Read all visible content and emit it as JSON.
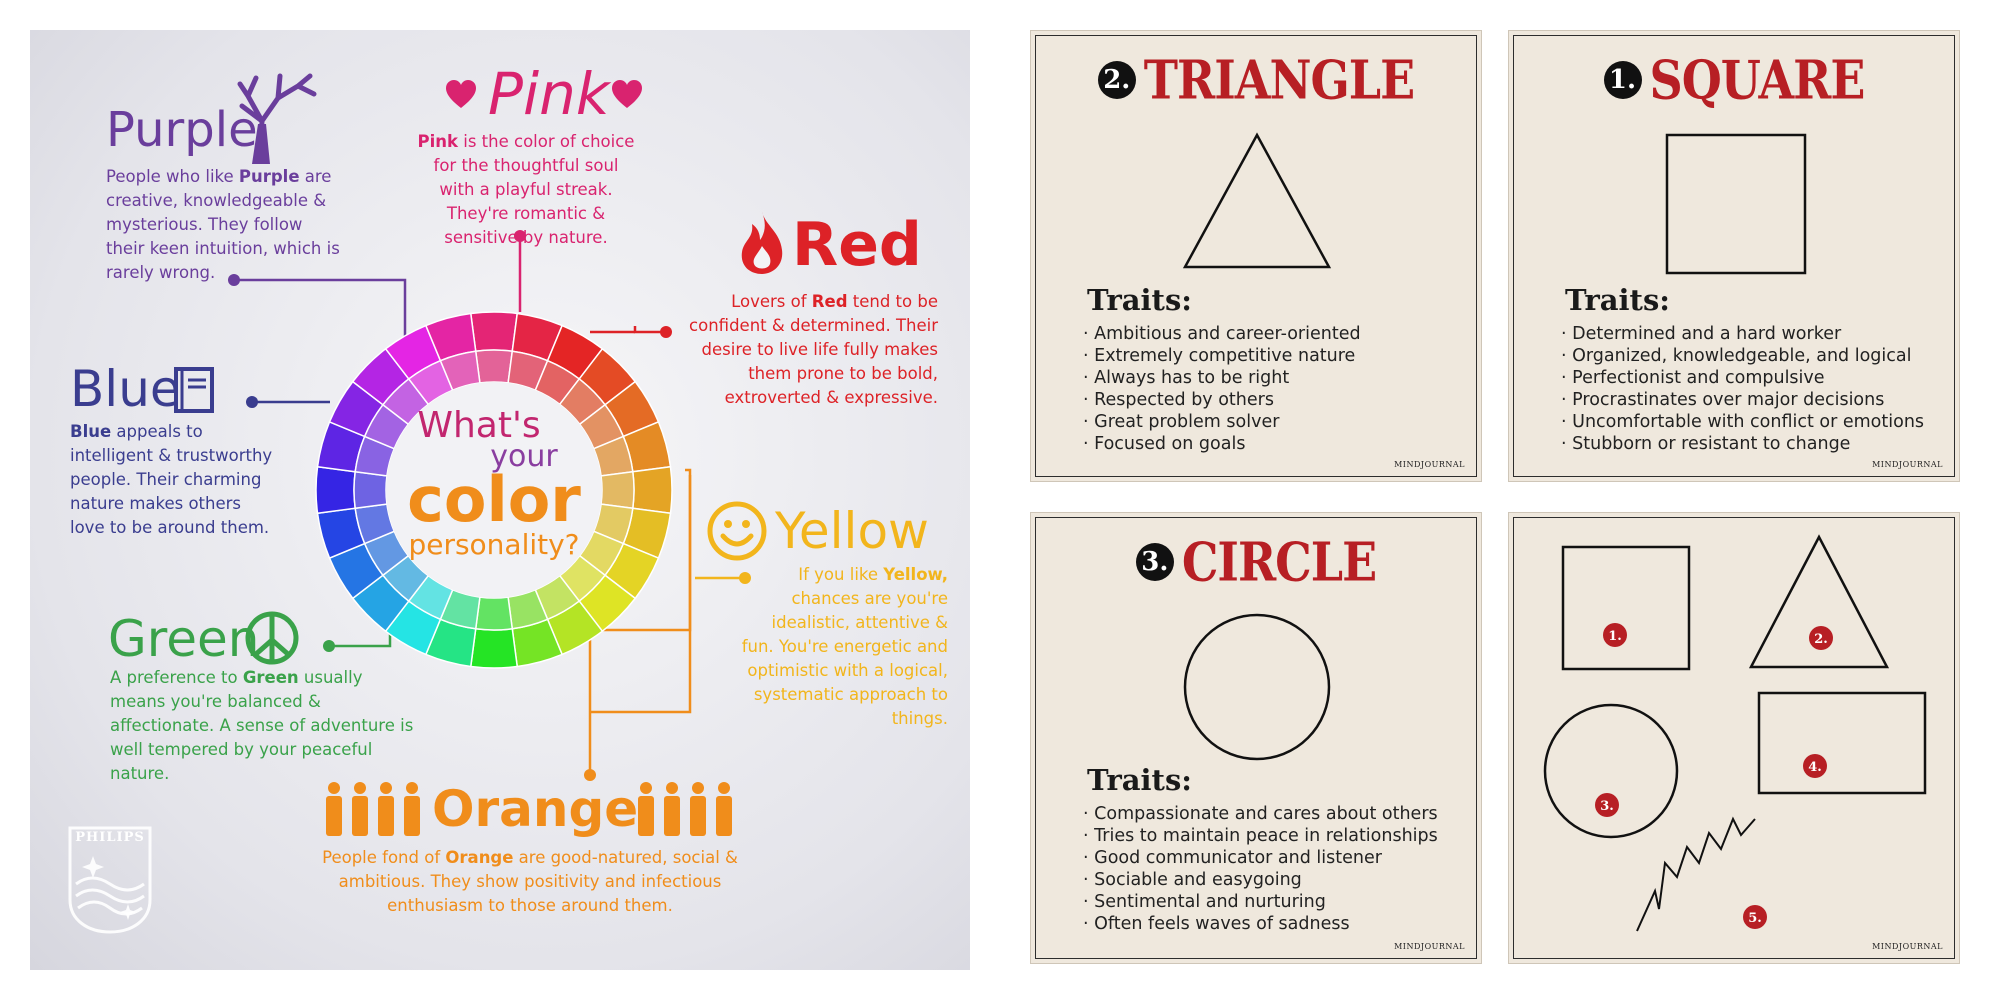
{
  "infographic": {
    "center": {
      "line1": "What's",
      "line2": "your",
      "line3": "color",
      "line4": "personality?"
    },
    "purple": {
      "title": "Purple",
      "text_pre": "People who like ",
      "text_bold": "Purple",
      "text_post": " are creative, knowledgeable & mysterious. They follow their keen intuition, which is rarely wrong."
    },
    "pink": {
      "title": "Pink",
      "text_bold": "Pink",
      "text_post": " is the color of choice for the thoughtful soul with a playful streak. They're romantic & sensitive by nature."
    },
    "red": {
      "title": "Red",
      "text_pre": "Lovers of ",
      "text_bold": "Red",
      "text_post": " tend to be confident & determined. Their desire to live life fully makes them prone to be bold, extroverted & expressive."
    },
    "blue": {
      "title": "Blue",
      "text_bold": "Blue",
      "text_post": " appeals to intelligent & trustworthy people. Their charming nature makes others love to be around them."
    },
    "yellow": {
      "title": "Yellow",
      "text_pre": "If you like ",
      "text_bold": "Yellow,",
      "text_post": " chances are you're idealistic, attentive & fun. You're energetic and optimistic with a logical, systematic approach to things."
    },
    "green": {
      "title": "Green",
      "text_pre": "A preference to ",
      "text_bold": "Green",
      "text_post": " usually means you're balanced & affectionate. A sense of adventure is well tempered by your peaceful nature."
    },
    "orange": {
      "title": "Orange",
      "text_pre": "People fond of ",
      "text_bold": "Orange",
      "text_post": " are good-natured, social & ambitious. They show positivity and infectious enthusiasm to those around them."
    },
    "brand": "PHILIPS",
    "colors": {
      "purple": "#6a3e9c",
      "pink": "#d9236f",
      "red": "#dd2227",
      "blue": "#3a3d8f",
      "green": "#3aa24a",
      "yellow": "#f2b51c",
      "orange": "#f08d1b"
    },
    "icons": [
      "tree-icon",
      "heart-icon",
      "flame-icon",
      "book-icon",
      "smiley-icon",
      "peace-icon",
      "people-icon",
      "philips-logo"
    ]
  },
  "cards": [
    {
      "num": "2.",
      "title": "TRIANGLE",
      "traits_label": "Traits:",
      "brand": "MINDJOURNAL",
      "traits": [
        "Ambitious and career-oriented",
        "Extremely competitive nature",
        "Always has to be right",
        "Respected by others",
        "Great problem solver",
        "Focused on goals"
      ]
    },
    {
      "num": "1.",
      "title": "SQUARE",
      "traits_label": "Traits:",
      "brand": "MINDJOURNAL",
      "traits": [
        "Determined and a hard worker",
        "Organized, knowledgeable, and logical",
        "Perfectionist and compulsive",
        "Procrastinates over major decisions",
        "Uncomfortable with conflict or emotions",
        "Stubborn or resistant to change"
      ]
    },
    {
      "num": "3.",
      "title": "CIRCLE",
      "traits_label": "Traits:",
      "brand": "MINDJOURNAL",
      "traits": [
        "Compassionate and cares about others",
        "Tries to maintain peace in relationships",
        "Good communicator and listener",
        "Sociable and easygoing",
        "Sentimental and nurturing",
        "Often feels waves of sadness"
      ]
    },
    {
      "brand": "MINDJOURNAL",
      "markers": [
        "1.",
        "2.",
        "3.",
        "4.",
        "5."
      ]
    }
  ],
  "card_colors": {
    "title_red": "#b71f24",
    "paper": "#efe8dd",
    "marker_red": "#b71f24"
  }
}
